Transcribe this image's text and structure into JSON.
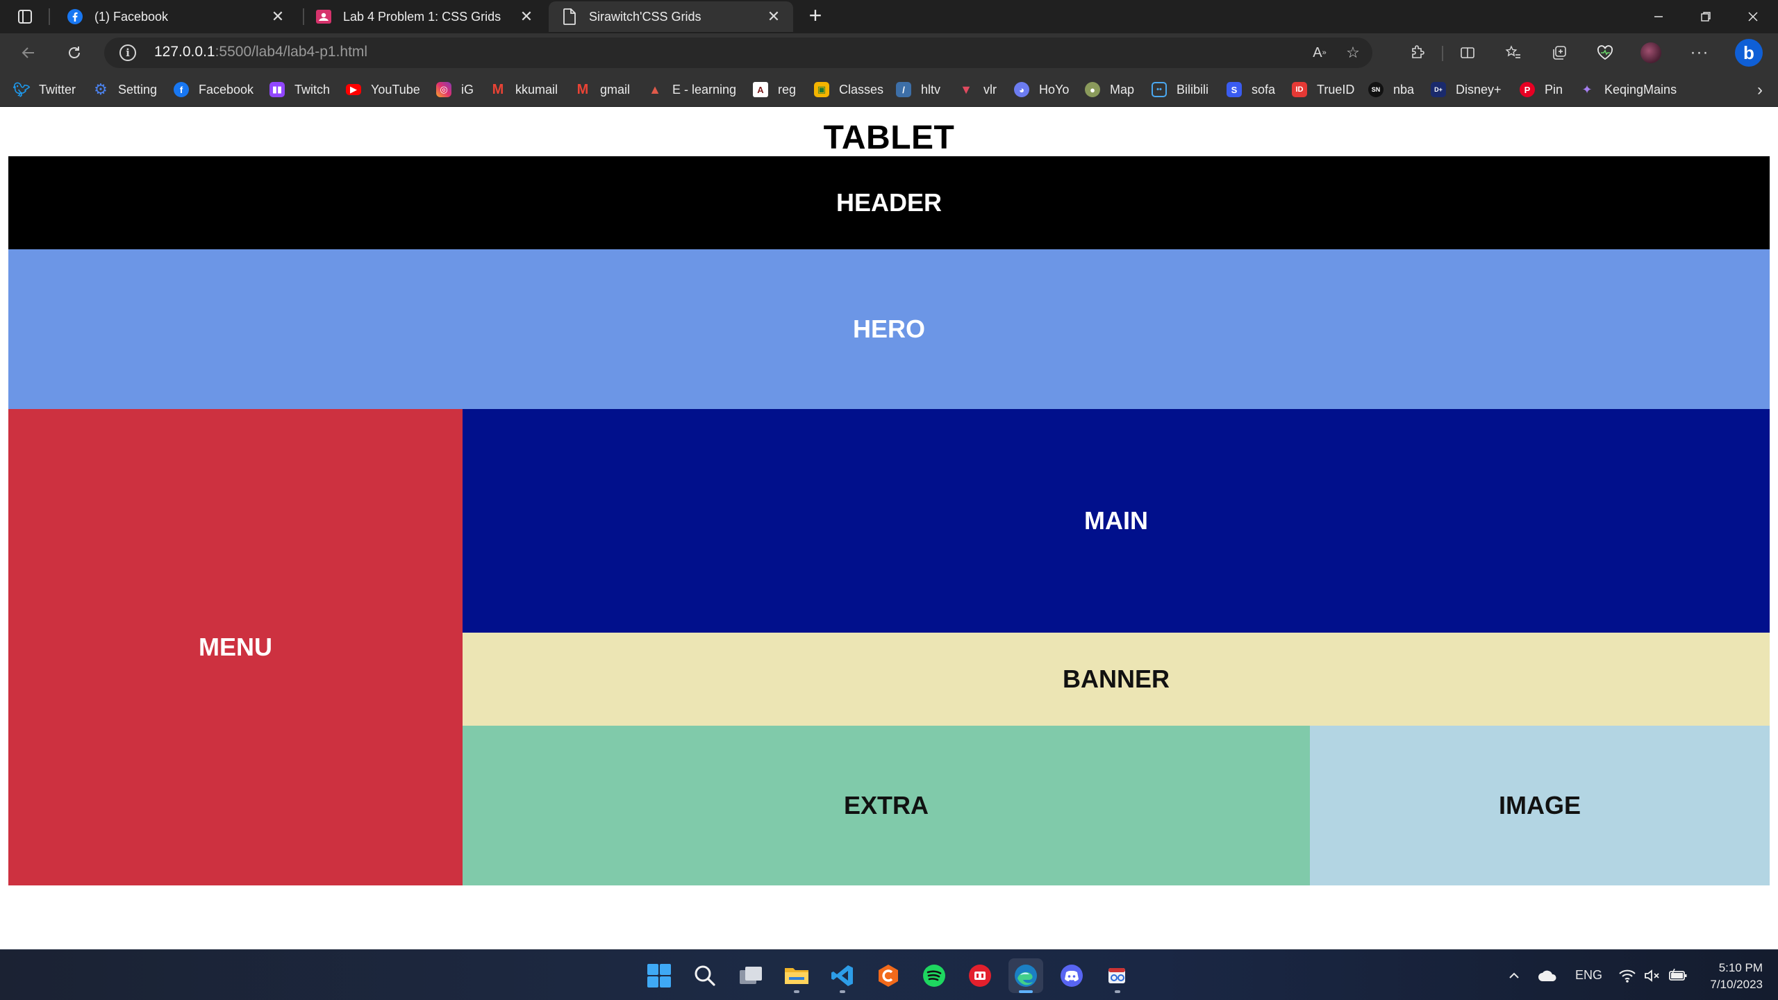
{
  "tabs": [
    {
      "title": "(1) Facebook",
      "icon": "facebook-icon",
      "active": false
    },
    {
      "title": "Lab 4 Problem 1: CSS Grids",
      "icon": "classroom-icon",
      "active": false
    },
    {
      "title": "Sirawitch'CSS Grids",
      "icon": "page-icon",
      "active": true
    }
  ],
  "address": {
    "host": "127.0.0.1",
    "rest": ":5500/lab4/lab4-p1.html"
  },
  "bookmarks": [
    {
      "label": "Twitter",
      "icon": "twitter-icon",
      "color": "#1d9bf0"
    },
    {
      "label": "Setting",
      "icon": "gear-icon",
      "color": "#3b6fd8"
    },
    {
      "label": "Facebook",
      "icon": "facebook-icon",
      "color": "#1877f2"
    },
    {
      "label": "Twitch",
      "icon": "twitch-icon",
      "color": "#9146ff"
    },
    {
      "label": "YouTube",
      "icon": "youtube-icon",
      "color": "#ff0000"
    },
    {
      "label": "iG",
      "icon": "instagram-icon",
      "color": "#e1306c"
    },
    {
      "label": "kkumail",
      "icon": "gmail-icon",
      "color": "#ea4335"
    },
    {
      "label": "gmail",
      "icon": "gmail-icon",
      "color": "#ea4335"
    },
    {
      "label": "E - learning",
      "icon": "rocket-icon",
      "color": "#c0392b"
    },
    {
      "label": "reg",
      "icon": "reg-icon",
      "color": "#ffffff"
    },
    {
      "label": "Classes",
      "icon": "classroom-icon",
      "color": "#f4b400"
    },
    {
      "label": "hltv",
      "icon": "hltv-icon",
      "color": "#3d6fa8"
    },
    {
      "label": "vlr",
      "icon": "vlr-icon",
      "color": "#e04a5f"
    },
    {
      "label": "HoYo",
      "icon": "hoyo-icon",
      "color": "#6c7cf0"
    },
    {
      "label": "Map",
      "icon": "map-icon",
      "color": "#8a9a5b"
    },
    {
      "label": "Bilibili",
      "icon": "bilibili-icon",
      "color": "#4aa8f0"
    },
    {
      "label": "sofa",
      "icon": "sofa-icon",
      "color": "#3a5cf0"
    },
    {
      "label": "TrueID",
      "icon": "trueid-icon",
      "color": "#e53935"
    },
    {
      "label": "nba",
      "icon": "sn-icon",
      "color": "#111111"
    },
    {
      "label": "Disney+",
      "icon": "disney-icon",
      "color": "#1a2a6c"
    },
    {
      "label": "Pin",
      "icon": "pinterest-icon",
      "color": "#e60023"
    },
    {
      "label": "KeqingMains",
      "icon": "keqing-icon",
      "color": "#8e6bd8"
    }
  ],
  "page": {
    "title": "TABLET",
    "cells": {
      "header": "HEADER",
      "hero": "HERO",
      "menu": "MENU",
      "main": "MAIN",
      "banner": "BANNER",
      "extra": "EXTRA",
      "image": "IMAGE"
    }
  },
  "taskbar": {
    "apps": [
      "start-icon",
      "search-icon",
      "task-view-icon",
      "file-explorer-icon",
      "vscode-icon",
      "app-orange-icon",
      "spotify-icon",
      "app-red-icon",
      "edge-icon",
      "discord-icon",
      "snipping-tool-icon"
    ],
    "language": "ENG",
    "time": "5:10 PM",
    "date": "7/10/2023"
  }
}
